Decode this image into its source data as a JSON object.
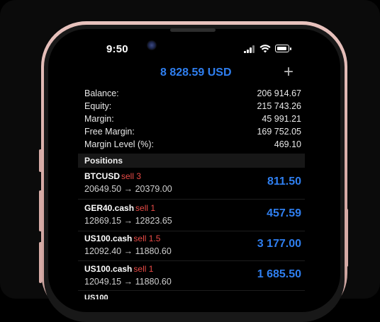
{
  "status_bar": {
    "time": "9:50"
  },
  "account": {
    "balance_header": "8 828.59 USD",
    "add_symbol": "+",
    "summary": [
      {
        "label": "Balance:",
        "value": "206 914.67"
      },
      {
        "label": "Equity:",
        "value": "215 743.26"
      },
      {
        "label": "Margin:",
        "value": "45 991.21"
      },
      {
        "label": "Free Margin:",
        "value": "169 752.05"
      },
      {
        "label": "Margin Level (%):",
        "value": "469.10"
      }
    ]
  },
  "positions": {
    "title": "Positions",
    "items": [
      {
        "symbol": "BTCUSD",
        "side": "sell 3",
        "open_price": "20649.50",
        "arrow": "→",
        "current_price": "20379.00",
        "profit": "811.50"
      },
      {
        "symbol": "GER40.cash",
        "side": "sell 1",
        "open_price": "12869.15",
        "arrow": "→",
        "current_price": "12823.65",
        "profit": "457.59"
      },
      {
        "symbol": "US100.cash",
        "side": "sell 1.5",
        "open_price": "12092.40",
        "arrow": "→",
        "current_price": "11880.60",
        "profit": "3 177.00"
      },
      {
        "symbol": "US100.cash",
        "side": "sell 1",
        "open_price": "12049.15",
        "arrow": "→",
        "current_price": "11880.60",
        "profit": "1 685.50"
      }
    ],
    "partial_symbol": "US100"
  },
  "colors": {
    "accent": "#2f7ff0",
    "sell": "#ea4b47",
    "frame": "#e8c2bd"
  },
  "icons": {
    "add": "plus-icon",
    "signal": "signal-bars-icon",
    "wifi": "wifi-icon",
    "battery": "battery-icon"
  }
}
